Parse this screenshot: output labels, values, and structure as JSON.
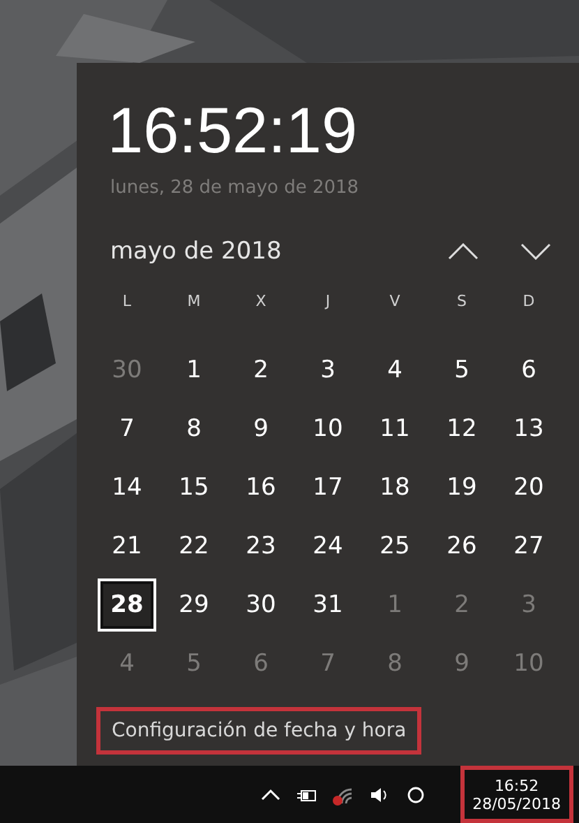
{
  "clock": {
    "time": "16:52:19",
    "date": "lunes, 28 de mayo de 2018"
  },
  "calendar": {
    "month": "mayo de 2018",
    "weekdays": [
      "L",
      "M",
      "X",
      "J",
      "V",
      "S",
      "D"
    ],
    "weeks": [
      [
        {
          "day": "30",
          "in_month": false,
          "selected": false
        },
        {
          "day": "1",
          "in_month": true,
          "selected": false
        },
        {
          "day": "2",
          "in_month": true,
          "selected": false
        },
        {
          "day": "3",
          "in_month": true,
          "selected": false
        },
        {
          "day": "4",
          "in_month": true,
          "selected": false
        },
        {
          "day": "5",
          "in_month": true,
          "selected": false
        },
        {
          "day": "6",
          "in_month": true,
          "selected": false
        }
      ],
      [
        {
          "day": "7",
          "in_month": true,
          "selected": false
        },
        {
          "day": "8",
          "in_month": true,
          "selected": false
        },
        {
          "day": "9",
          "in_month": true,
          "selected": false
        },
        {
          "day": "10",
          "in_month": true,
          "selected": false
        },
        {
          "day": "11",
          "in_month": true,
          "selected": false
        },
        {
          "day": "12",
          "in_month": true,
          "selected": false
        },
        {
          "day": "13",
          "in_month": true,
          "selected": false
        }
      ],
      [
        {
          "day": "14",
          "in_month": true,
          "selected": false
        },
        {
          "day": "15",
          "in_month": true,
          "selected": false
        },
        {
          "day": "16",
          "in_month": true,
          "selected": false
        },
        {
          "day": "17",
          "in_month": true,
          "selected": false
        },
        {
          "day": "18",
          "in_month": true,
          "selected": false
        },
        {
          "day": "19",
          "in_month": true,
          "selected": false
        },
        {
          "day": "20",
          "in_month": true,
          "selected": false
        }
      ],
      [
        {
          "day": "21",
          "in_month": true,
          "selected": false
        },
        {
          "day": "22",
          "in_month": true,
          "selected": false
        },
        {
          "day": "23",
          "in_month": true,
          "selected": false
        },
        {
          "day": "24",
          "in_month": true,
          "selected": false
        },
        {
          "day": "25",
          "in_month": true,
          "selected": false
        },
        {
          "day": "26",
          "in_month": true,
          "selected": false
        },
        {
          "day": "27",
          "in_month": true,
          "selected": false
        }
      ],
      [
        {
          "day": "28",
          "in_month": true,
          "selected": true
        },
        {
          "day": "29",
          "in_month": true,
          "selected": false
        },
        {
          "day": "30",
          "in_month": true,
          "selected": false
        },
        {
          "day": "31",
          "in_month": true,
          "selected": false
        },
        {
          "day": "1",
          "in_month": false,
          "selected": false
        },
        {
          "day": "2",
          "in_month": false,
          "selected": false
        },
        {
          "day": "3",
          "in_month": false,
          "selected": false
        }
      ],
      [
        {
          "day": "4",
          "in_month": false,
          "selected": false
        },
        {
          "day": "5",
          "in_month": false,
          "selected": false
        },
        {
          "day": "6",
          "in_month": false,
          "selected": false
        },
        {
          "day": "7",
          "in_month": false,
          "selected": false
        },
        {
          "day": "8",
          "in_month": false,
          "selected": false
        },
        {
          "day": "9",
          "in_month": false,
          "selected": false
        },
        {
          "day": "10",
          "in_month": false,
          "selected": false
        }
      ]
    ]
  },
  "settings_link": {
    "label": "Configuración de fecha y hora",
    "highlighted": true
  },
  "taskbar": {
    "clock_time": "16:52",
    "clock_date": "28/05/2018",
    "clock_highlighted": true
  }
}
